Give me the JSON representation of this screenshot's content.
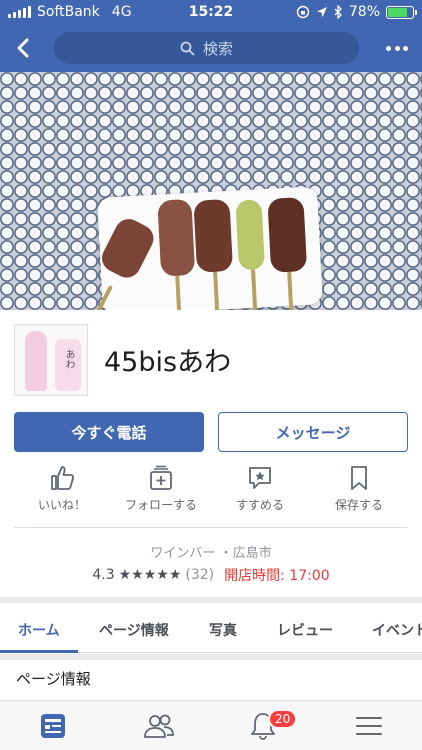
{
  "status_bar": {
    "carrier": "SoftBank",
    "network": "4G",
    "time": "15:22",
    "battery": "78%",
    "battery_level": 0.78
  },
  "navbar": {
    "search_placeholder": "検索",
    "back_icon": "chevron-left-icon",
    "more_icon": "more-dots-icon"
  },
  "page": {
    "name": "45bisあわ"
  },
  "buttons": {
    "call": "今すぐ電話",
    "message": "メッセージ"
  },
  "actions": [
    {
      "label": "いいね！",
      "icon": "like-icon"
    },
    {
      "label": "フォローする",
      "icon": "follow-icon"
    },
    {
      "label": "すすめる",
      "icon": "recommend-icon"
    },
    {
      "label": "保存する",
      "icon": "bookmark-icon"
    }
  ],
  "info": {
    "category": "ワインバー",
    "location": "広島市",
    "separator": "・",
    "rating": "4.3",
    "stars": "★★★★★",
    "rating_value": 4.3,
    "review_count": "(32)",
    "hours": "開店時間: 17:00"
  },
  "tabs": [
    {
      "label": "ホーム",
      "active": true
    },
    {
      "label": "ページ情報",
      "active": false
    },
    {
      "label": "写真",
      "active": false
    },
    {
      "label": "レビュー",
      "active": false
    },
    {
      "label": "イベント",
      "active": false
    }
  ],
  "section": {
    "title": "ページ情報"
  },
  "bottom_bar": {
    "items": [
      "news-feed-icon",
      "friends-icon",
      "notifications-icon",
      "menu-icon"
    ],
    "notification_count": "20"
  },
  "colors": {
    "brand": "#4267b2",
    "alert": "#fa3e3e",
    "hours": "#e53935"
  }
}
